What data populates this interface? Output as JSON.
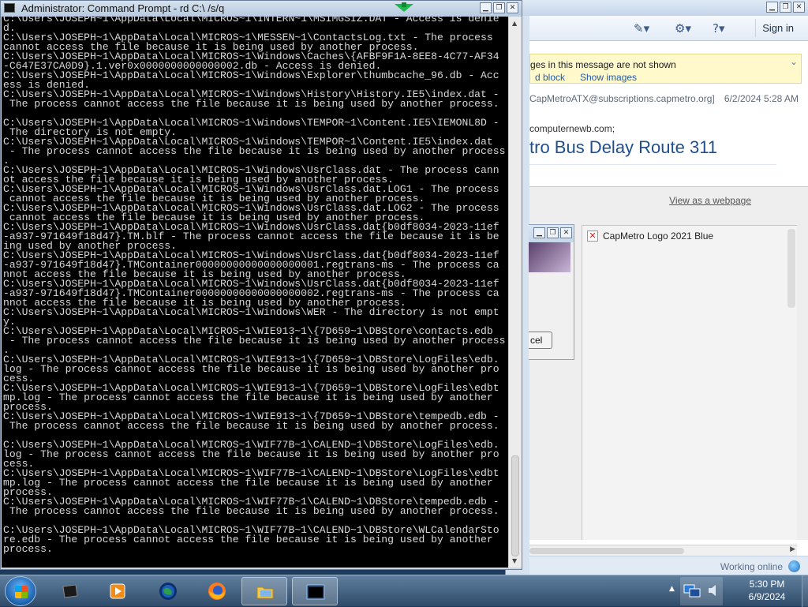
{
  "cmd": {
    "title": "Administrator: Command Prompt - rd  C:\\ /s/q",
    "lines": [
      "C:\\Users\\JOSEPH~1\\AppData\\Local\\MICROS~1\\INTERN~1\\MSIMGSIZ.DAT - Access is denie",
      "d.",
      "C:\\Users\\JOSEPH~1\\AppData\\Local\\MICROS~1\\MESSEN~1\\ContactsLog.txt - The process",
      "cannot access the file because it is being used by another process.",
      "C:\\Users\\JOSEPH~1\\AppData\\Local\\MICROS~1\\Windows\\Caches\\{AFBF9F1A-8EE8-4C77-AF34",
      "-C647E37CA0D9}.1.ver0x0000000000000002.db - Access is denied.",
      "C:\\Users\\JOSEPH~1\\AppData\\Local\\MICROS~1\\Windows\\Explorer\\thumbcache_96.db - Acc",
      "ess is denied.",
      "C:\\Users\\JOSEPH~1\\AppData\\Local\\MICROS~1\\Windows\\History\\History.IE5\\index.dat -",
      " The process cannot access the file because it is being used by another process.",
      "",
      "C:\\Users\\JOSEPH~1\\AppData\\Local\\MICROS~1\\Windows\\TEMPOR~1\\Content.IE5\\IEMONL8D -",
      " The directory is not empty.",
      "C:\\Users\\JOSEPH~1\\AppData\\Local\\MICROS~1\\Windows\\TEMPOR~1\\Content.IE5\\index.dat",
      " - The process cannot access the file because it is being used by another process",
      ".",
      "C:\\Users\\JOSEPH~1\\AppData\\Local\\MICROS~1\\Windows\\UsrClass.dat - The process cann",
      "ot access the file because it is being used by another process.",
      "C:\\Users\\JOSEPH~1\\AppData\\Local\\MICROS~1\\Windows\\UsrClass.dat.LOG1 - The process",
      " cannot access the file because it is being used by another process.",
      "C:\\Users\\JOSEPH~1\\AppData\\Local\\MICROS~1\\Windows\\UsrClass.dat.LOG2 - The process",
      " cannot access the file because it is being used by another process.",
      "C:\\Users\\JOSEPH~1\\AppData\\Local\\MICROS~1\\Windows\\UsrClass.dat{b0df8034-2023-11ef",
      "-a937-971649f18d47}.TM.blf - The process cannot access the file because it is be",
      "ing used by another process.",
      "C:\\Users\\JOSEPH~1\\AppData\\Local\\MICROS~1\\Windows\\UsrClass.dat{b0df8034-2023-11ef",
      "-a937-971649f18d47}.TMContainer00000000000000000001.regtrans-ms - The process ca",
      "nnot access the file because it is being used by another process.",
      "C:\\Users\\JOSEPH~1\\AppData\\Local\\MICROS~1\\Windows\\UsrClass.dat{b0df8034-2023-11ef",
      "-a937-971649f18d47}.TMContainer00000000000000000002.regtrans-ms - The process ca",
      "nnot access the file because it is being used by another process.",
      "C:\\Users\\JOSEPH~1\\AppData\\Local\\MICROS~1\\Windows\\WER - The directory is not empt",
      "y.",
      "C:\\Users\\JOSEPH~1\\AppData\\Local\\MICROS~1\\WIE913~1\\{7D659~1\\DBStore\\contacts.edb",
      " - The process cannot access the file because it is being used by another process",
      ".",
      "C:\\Users\\JOSEPH~1\\AppData\\Local\\MICROS~1\\WIE913~1\\{7D659~1\\DBStore\\LogFiles\\edb.",
      "log - The process cannot access the file because it is being used by another pro",
      "cess.",
      "C:\\Users\\JOSEPH~1\\AppData\\Local\\MICROS~1\\WIE913~1\\{7D659~1\\DBStore\\LogFiles\\edbt",
      "mp.log - The process cannot access the file because it is being used by another",
      "process.",
      "C:\\Users\\JOSEPH~1\\AppData\\Local\\MICROS~1\\WIE913~1\\{7D659~1\\DBStore\\tempedb.edb -",
      " The process cannot access the file because it is being used by another process.",
      "",
      "C:\\Users\\JOSEPH~1\\AppData\\Local\\MICROS~1\\WIF77B~1\\CALEND~1\\DBStore\\LogFiles\\edb.",
      "log - The process cannot access the file because it is being used by another pro",
      "cess.",
      "C:\\Users\\JOSEPH~1\\AppData\\Local\\MICROS~1\\WIF77B~1\\CALEND~1\\DBStore\\LogFiles\\edbt",
      "mp.log - The process cannot access the file because it is being used by another",
      "process.",
      "C:\\Users\\JOSEPH~1\\AppData\\Local\\MICROS~1\\WIF77B~1\\CALEND~1\\DBStore\\tempedb.edb -",
      " The process cannot access the file because it is being used by another process.",
      "",
      "C:\\Users\\JOSEPH~1\\AppData\\Local\\MICROS~1\\WIF77B~1\\CALEND~1\\DBStore\\WLCalendarSto",
      "re.edb - The process cannot access the file because it is being used by another",
      "process."
    ]
  },
  "mail": {
    "sign_in": "Sign in",
    "infobar_text": "ges in this message are not shown",
    "infobar_link_block": "d block",
    "infobar_link_show": "Show images",
    "from": "CapMetroATX@subscriptions.capmetro.org]",
    "date": "6/2/2024 5:28 AM",
    "to": "computernewb.com;",
    "subject": "tro Bus Delay Route 311",
    "view_webpage": "View as a webpage",
    "image_alt": "CapMetro Logo 2021 Blue",
    "status": "Working online",
    "dialog_cancel": "cel"
  },
  "taskbar": {
    "time": "5:30 PM",
    "date": "6/9/2024",
    "apps": [
      "terminal-icon",
      "media-player-icon",
      "globe-icon",
      "firefox-icon",
      "folder-icon",
      "command-prompt-icon"
    ]
  },
  "colors": {
    "console_bg": "#000000",
    "console_fg": "#d8d8d8",
    "link": "#1f5bb0",
    "subject": "#1f4e8c",
    "infobar": "#fff9cc"
  }
}
